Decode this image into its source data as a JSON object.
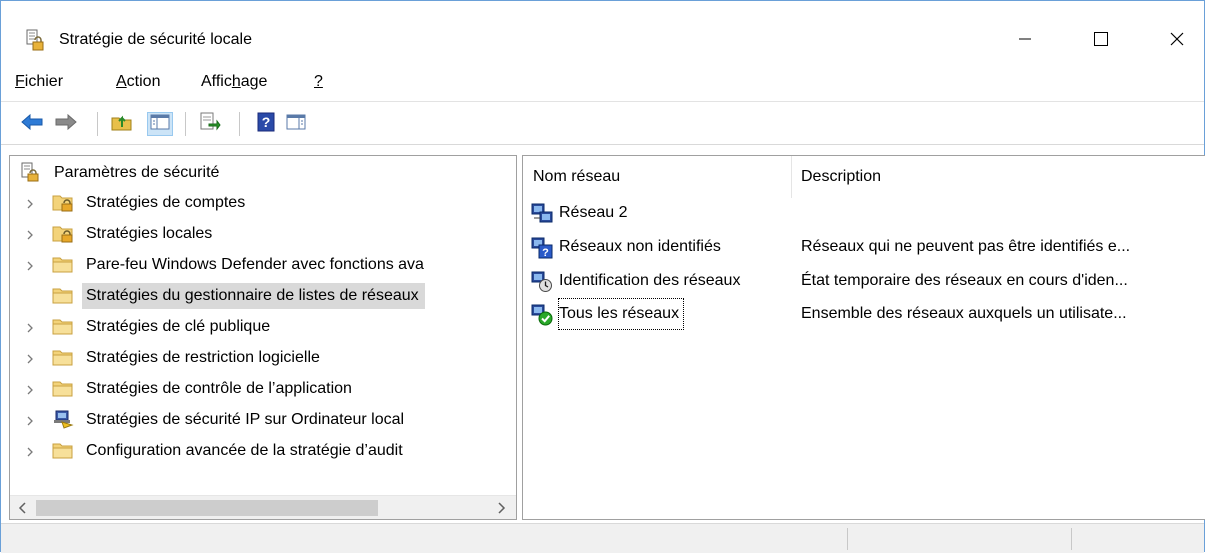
{
  "window": {
    "title": "Stratégie de sécurité locale",
    "icon": "local-security-policy-icon"
  },
  "menu": {
    "items": [
      {
        "prefix": "",
        "accel": "F",
        "rest": "ichier"
      },
      {
        "prefix": "",
        "accel": "A",
        "rest": "ction"
      },
      {
        "prefix": "Affic",
        "accel": "h",
        "rest": "age"
      },
      {
        "prefix": "",
        "accel": "?",
        "rest": ""
      }
    ]
  },
  "toolbar": {
    "buttons": [
      "back-arrow-icon",
      "forward-arrow-icon",
      "up-folder-icon",
      "show-hide-console-tree-icon",
      "export-list-icon",
      "help-icon",
      "action-pane-icon"
    ]
  },
  "tree": {
    "root": "Paramètres de sécurité",
    "items": [
      {
        "label": "Stratégies de comptes",
        "icon": "locked-folder-icon"
      },
      {
        "label": "Stratégies locales",
        "icon": "locked-folder-icon"
      },
      {
        "label": "Pare-feu Windows Defender avec fonctions ava",
        "icon": "folder-icon"
      },
      {
        "label": "Stratégies du gestionnaire de listes de réseaux",
        "icon": "folder-icon",
        "selected": true
      },
      {
        "label": "Stratégies de clé publique",
        "icon": "folder-icon"
      },
      {
        "label": "Stratégies de restriction logicielle",
        "icon": "folder-icon"
      },
      {
        "label": "Stratégies de contrôle de l’application",
        "icon": "folder-icon"
      },
      {
        "label": "Stratégies de sécurité IP sur Ordinateur local",
        "icon": "ip-security-icon"
      },
      {
        "label": "Configuration avancée de la stratégie d’audit",
        "icon": "folder-icon"
      }
    ]
  },
  "list": {
    "columns": [
      "Nom réseau",
      "Description"
    ],
    "rows": [
      {
        "name": "Réseau  2",
        "description": "",
        "icon": "network-icon"
      },
      {
        "name": "Réseaux non identifiés",
        "description": "Réseaux qui ne peuvent pas être identifiés e...",
        "icon": "unidentified-network-icon"
      },
      {
        "name": "Identification des réseaux",
        "description": "État temporaire des réseaux en cours d'iden...",
        "icon": "identifying-network-icon"
      },
      {
        "name": "Tous les réseaux",
        "description": "Ensemble des réseaux auxquels un utilisate...",
        "icon": "all-networks-icon"
      }
    ]
  },
  "colors": {
    "selection": "#d9d9d9",
    "window_border": "#6aa0d8",
    "scrollbar_thumb": "#cdcdcd"
  }
}
